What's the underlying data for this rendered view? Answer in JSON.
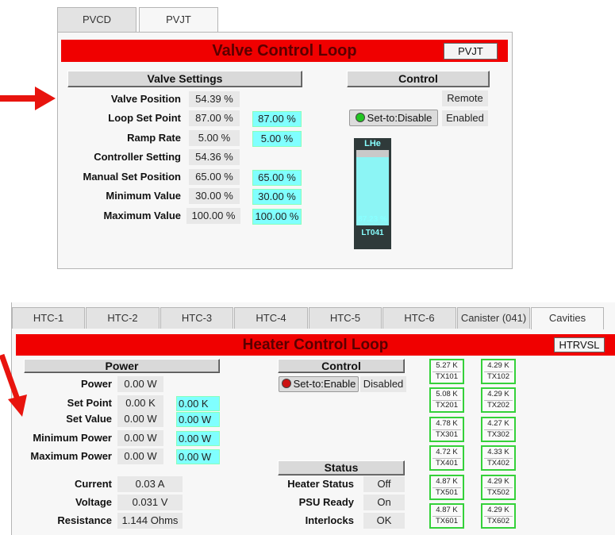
{
  "colors": {
    "header_red": "#f00000",
    "setpoint_cyan": "#80ffff",
    "led_green": "#22c522",
    "led_red": "#cc1111",
    "tx_border": "#35d13a",
    "arrow": "#e8140e"
  },
  "valve_panel": {
    "tabs": [
      {
        "label": "PVCD"
      },
      {
        "label": "PVJT"
      }
    ],
    "title": "Valve Control Loop",
    "tag_button": "PVJT",
    "settings_header": "Valve Settings",
    "control_header": "Control",
    "rows": [
      {
        "label": "Valve Position",
        "value": "54.39 %",
        "setpoint": ""
      },
      {
        "label": "Loop Set Point",
        "value": "87.00 %",
        "setpoint": "87.00 %"
      },
      {
        "label": "Ramp Rate",
        "value": "5.00 %",
        "setpoint": "5.00 %"
      },
      {
        "label": "Controller Setting",
        "value": "54.36 %",
        "setpoint": ""
      },
      {
        "label": "Manual Set Position",
        "value": "65.00 %",
        "setpoint": "65.00 %"
      },
      {
        "label": "Minimum Value",
        "value": "30.00 %",
        "setpoint": "30.00 %"
      },
      {
        "label": "Maximum Value",
        "value": "100.00 %",
        "setpoint": "100.00 %"
      }
    ],
    "control": {
      "mode": "Remote",
      "button": "Set-to:Disable",
      "led_icon": "green-led-icon",
      "state": "Enabled"
    },
    "level_gauge": {
      "label": "LHe",
      "value": "87.23 %",
      "tag": "LT041",
      "level_fraction": 0.87
    }
  },
  "heater_panel": {
    "tabs": [
      {
        "label": "HTC-1"
      },
      {
        "label": "HTC-2"
      },
      {
        "label": "HTC-3"
      },
      {
        "label": "HTC-4"
      },
      {
        "label": "HTC-5"
      },
      {
        "label": "HTC-6"
      },
      {
        "label": "Canister (041)"
      },
      {
        "label": "Cavities"
      }
    ],
    "title": "Heater Control Loop",
    "tag_button": "HTRVSL",
    "power_header": "Power",
    "power_rows": [
      {
        "label": "Power",
        "value": "0.00 W",
        "setpoint": ""
      },
      {
        "label": "Set Point",
        "value": "0.00 K",
        "setpoint": "0.00 K"
      },
      {
        "label": "Set Value",
        "value": "0.00 W",
        "setpoint": "0.00 W"
      },
      {
        "label": "Minimum Power",
        "value": "0.00 W",
        "setpoint": "0.00 W"
      },
      {
        "label": "Maximum Power",
        "value": "0.00 W",
        "setpoint": "0.00 W"
      }
    ],
    "measure_rows": [
      {
        "label": "Current",
        "value": "0.03 A"
      },
      {
        "label": "Voltage",
        "value": "0.031 V"
      },
      {
        "label": "Resistance",
        "value": "1.144 Ohms"
      }
    ],
    "control_header": "Control",
    "control": {
      "button": "Set-to:Enable",
      "led_icon": "red-led-icon",
      "state": "Disabled"
    },
    "status_header": "Status",
    "status_rows": [
      {
        "label": "Heater Status",
        "value": "Off"
      },
      {
        "label": "PSU Ready",
        "value": "On"
      },
      {
        "label": "Interlocks",
        "value": "OK"
      }
    ],
    "sensors": [
      {
        "value": "5.27 K",
        "name": "TX101"
      },
      {
        "value": "4.29 K",
        "name": "TX102"
      },
      {
        "value": "5.08 K",
        "name": "TX201"
      },
      {
        "value": "4.29 K",
        "name": "TX202"
      },
      {
        "value": "4.78 K",
        "name": "TX301"
      },
      {
        "value": "4.27 K",
        "name": "TX302"
      },
      {
        "value": "4.72 K",
        "name": "TX401"
      },
      {
        "value": "4.33 K",
        "name": "TX402"
      },
      {
        "value": "4.87 K",
        "name": "TX501"
      },
      {
        "value": "4.29 K",
        "name": "TX502"
      },
      {
        "value": "4.87 K",
        "name": "TX601"
      },
      {
        "value": "4.29 K",
        "name": "TX602"
      }
    ]
  }
}
